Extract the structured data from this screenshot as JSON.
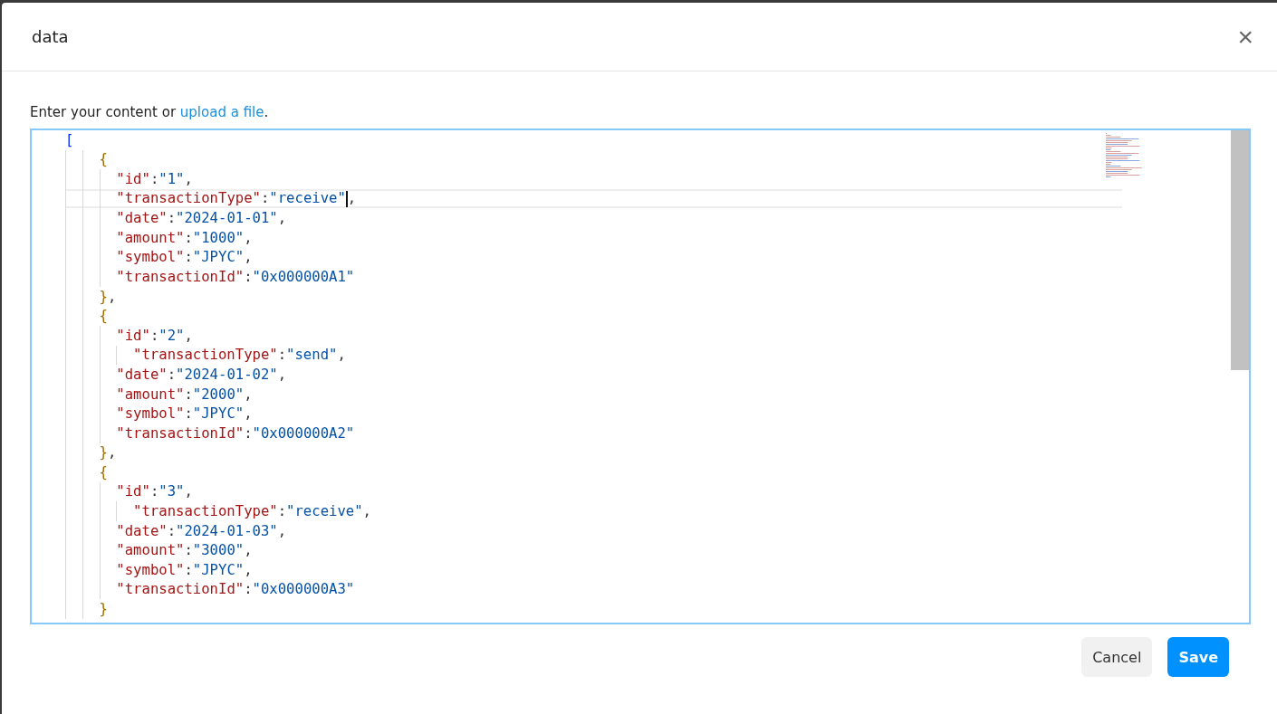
{
  "dialog": {
    "title": "data",
    "close": "×"
  },
  "intro": {
    "text": "Enter your content or ",
    "link": "upload a file",
    "end": "."
  },
  "editor": {
    "lines": [
      {
        "text": "[",
        "selected": false
      },
      {
        "text": "    {",
        "selected": false
      },
      {
        "text": "      \"id\":\"1\",",
        "selected": false
      },
      {
        "text": "      \"transactionType\":\"receive\"",
        "after_cursor": ",",
        "selected": true
      },
      {
        "text": "      \"date\":\"2024-01-01\",",
        "selected": false
      },
      {
        "text": "      \"amount\":\"1000\",",
        "selected": false
      },
      {
        "text": "      \"symbol\":\"JPYC\",",
        "selected": false
      },
      {
        "text": "      \"transactionId\":\"0x000000A1\"",
        "selected": false
      },
      {
        "text": "    },",
        "selected": false
      },
      {
        "text": "    {",
        "selected": false
      },
      {
        "text": "      \"id\":\"2\",",
        "selected": false
      },
      {
        "text": "        \"transactionType\":\"send\",",
        "selected": false
      },
      {
        "text": "      \"date\":\"2024-01-02\",",
        "selected": false
      },
      {
        "text": "      \"amount\":\"2000\",",
        "selected": false
      },
      {
        "text": "      \"symbol\":\"JPYC\",",
        "selected": false
      },
      {
        "text": "      \"transactionId\":\"0x000000A2\"",
        "selected": false
      },
      {
        "text": "    },",
        "selected": false
      },
      {
        "text": "    {",
        "selected": false
      },
      {
        "text": "      \"id\":\"3\",",
        "selected": false
      },
      {
        "text": "        \"transactionType\":\"receive\",",
        "selected": false
      },
      {
        "text": "      \"date\":\"2024-01-03\",",
        "selected": false
      },
      {
        "text": "      \"amount\":\"3000\",",
        "selected": false
      },
      {
        "text": "      \"symbol\":\"JPYC\",",
        "selected": false
      },
      {
        "text": "      \"transactionId\":\"0x000000A3\"",
        "selected": false
      },
      {
        "text": "    }",
        "selected": false
      }
    ]
  },
  "buttons": [
    {
      "label": "Cancel",
      "kind": "secondary"
    },
    {
      "label": "Save",
      "kind": "primary"
    }
  ]
}
